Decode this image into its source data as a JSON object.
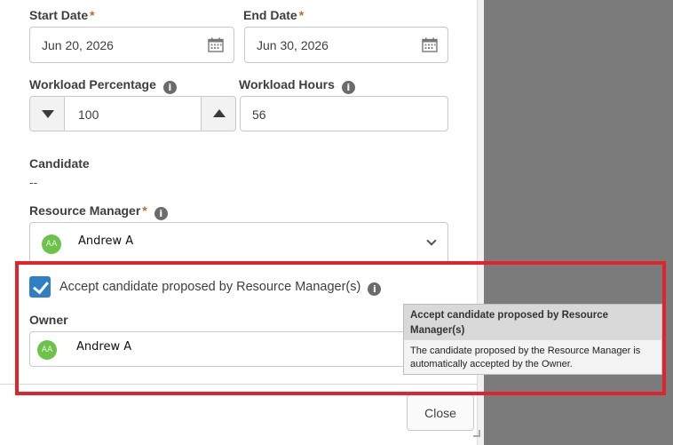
{
  "form": {
    "start_date": {
      "label": "Start Date",
      "required": "*",
      "value": "Jun 20, 2026"
    },
    "end_date": {
      "label": "End Date",
      "required": "*",
      "value": "Jun 30, 2026"
    },
    "workload_percentage": {
      "label": "Workload Percentage",
      "value": "100"
    },
    "workload_hours": {
      "label": "Workload Hours",
      "value": "56"
    },
    "candidate": {
      "label": "Candidate",
      "value": "--"
    },
    "resource_manager": {
      "label": "Resource Manager",
      "required": "*",
      "avatar_initials": "AA",
      "value": "Andrew A"
    },
    "accept_candidate": {
      "label": "Accept candidate proposed by Resource Manager(s)",
      "checked": true
    },
    "owner": {
      "label": "Owner",
      "avatar_initials": "AA",
      "value": "Andrew A"
    }
  },
  "tooltip": {
    "title": "Accept candidate proposed by Resource Manager(s)",
    "body": "The candidate proposed by the Resource Manager is automatically accepted by the Owner."
  },
  "footer": {
    "close_label": "Close"
  },
  "icons": {
    "info": "i",
    "calendar": "calendar-icon",
    "chevron": "chevron-down-icon"
  },
  "colors": {
    "accent": "#2f7fc5",
    "avatar": "#6cc24a",
    "required": "#c26a2a",
    "highlight": "#e0242d"
  }
}
